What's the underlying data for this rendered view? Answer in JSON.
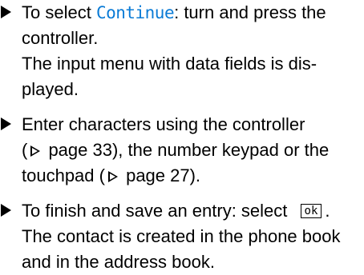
{
  "steps": [
    {
      "lines": [
        {
          "pre": "To select ",
          "term": "Continue",
          "post": ": turn and press the"
        },
        {
          "text": "controller."
        },
        {
          "text": "The input menu with data fields is dis-"
        },
        {
          "text": "played."
        }
      ]
    },
    {
      "lines": [
        {
          "text": "Enter characters using the controller"
        },
        {
          "pre": "(",
          "post": " page 33), the number keypad or the"
        },
        {
          "pre": "touchpad (",
          "post": " page 27)."
        }
      ]
    },
    {
      "lines": [
        {
          "pre": "To finish and save an entry: select ",
          "key": "ok",
          "post": "."
        },
        {
          "text": "The contact is created in the phone book"
        },
        {
          "text": "and in the address book."
        }
      ]
    }
  ],
  "colors": {
    "ui_term": "#0a7bd6",
    "text": "#000000"
  }
}
